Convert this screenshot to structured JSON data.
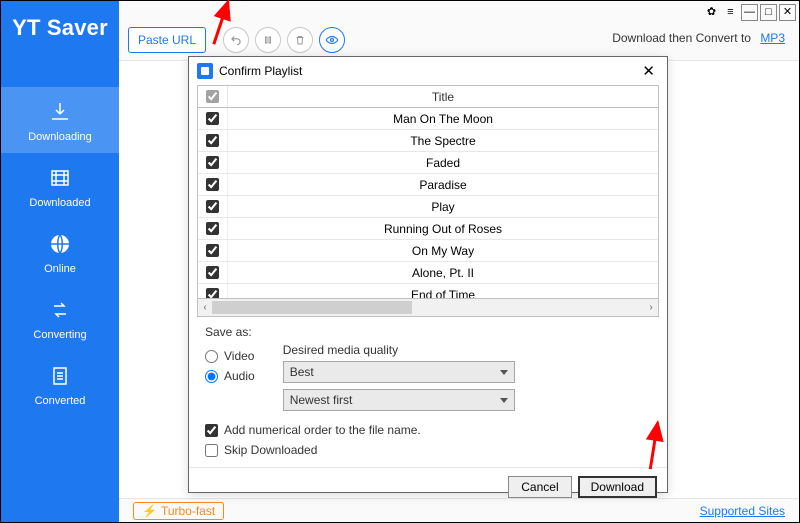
{
  "app": {
    "title": "YT Saver"
  },
  "sidebar": {
    "items": [
      {
        "label": "Downloading"
      },
      {
        "label": "Downloaded"
      },
      {
        "label": "Online"
      },
      {
        "label": "Converting"
      },
      {
        "label": "Converted"
      }
    ]
  },
  "toolbar": {
    "paste_label": "Paste URL",
    "convert_label": "Download then Convert to",
    "convert_format": "MP3"
  },
  "dialog": {
    "title": "Confirm Playlist",
    "column_title": "Title",
    "rows": [
      "Man On The Moon",
      "The Spectre",
      "Faded",
      "Paradise",
      "Play",
      "Running Out of Roses",
      "On My Way",
      "Alone, Pt. II",
      "End of Time"
    ],
    "save_as_label": "Save as:",
    "video_label": "Video",
    "audio_label": "Audio",
    "quality_label": "Desired media quality",
    "quality_value": "Best",
    "sort_value": "Newest first",
    "add_num_label": "Add numerical order to the file name.",
    "skip_label": "Skip Downloaded",
    "cancel": "Cancel",
    "download": "Download"
  },
  "footer": {
    "turbo": "Turbo-fast",
    "supported": "Supported Sites"
  }
}
